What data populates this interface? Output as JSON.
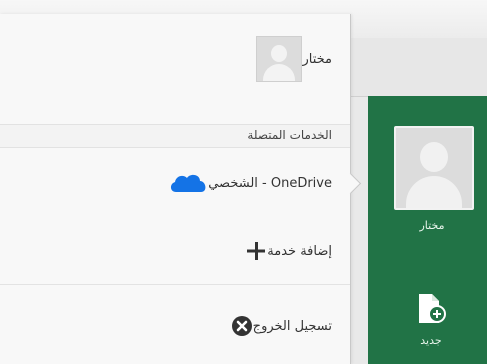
{
  "account": {
    "user_name": "مختار"
  },
  "connected_services": {
    "header": "الخدمات المتصلة",
    "services": [
      {
        "label": "OneDrive - الشخصي"
      }
    ],
    "add_service_label": "إضافة خدمة"
  },
  "sign_out_label": "تسجيل الخروج",
  "backstage": {
    "user_label": "مختار",
    "new_label": "جديد"
  },
  "colors": {
    "excel_green": "#217346",
    "onedrive_blue": "#1473e6"
  }
}
